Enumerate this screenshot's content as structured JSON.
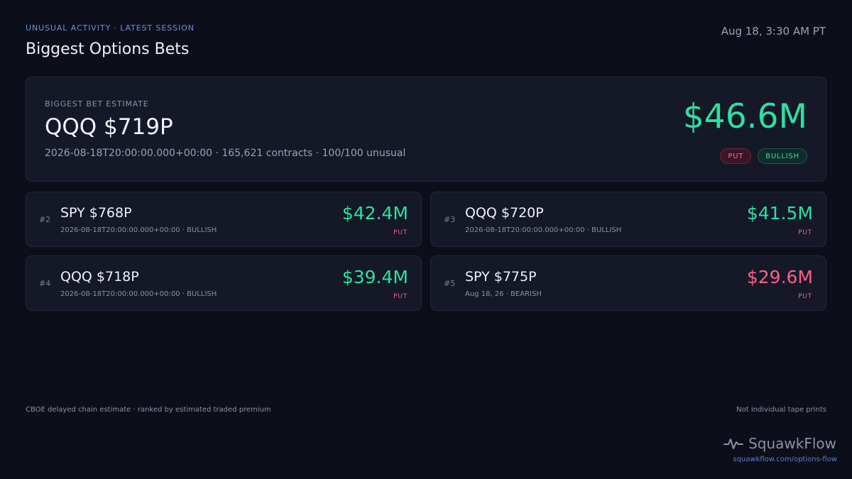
{
  "header": {
    "kicker": "UNUSUAL ACTIVITY · LATEST SESSION",
    "title": "Biggest Options Bets",
    "timestamp": "Aug 18, 3:30 AM PT"
  },
  "hero": {
    "label": "BIGGEST BET ESTIMATE",
    "contract": "QQQ $719P",
    "meta": "2026-08-18T20:00:00.000+00:00 · 165,621 contracts · 100/100 unusual",
    "premium": "$46.6M",
    "badges": {
      "type": "PUT",
      "sentiment": "BULLISH"
    }
  },
  "bets": [
    {
      "rank": "#2",
      "contract": "SPY $768P",
      "meta": "2026-08-18T20:00:00.000+00:00 · BULLISH",
      "premium": "$42.4M",
      "type": "PUT"
    },
    {
      "rank": "#3",
      "contract": "QQQ $720P",
      "meta": "2026-08-18T20:00:00.000+00:00 · BULLISH",
      "premium": "$41.5M",
      "type": "PUT"
    },
    {
      "rank": "#4",
      "contract": "QQQ $718P",
      "meta": "2026-08-18T20:00:00.000+00:00 · BULLISH",
      "premium": "$39.4M",
      "type": "PUT"
    },
    {
      "rank": "#5",
      "contract": "SPY $775P",
      "meta": "Aug 18, 26 · BEARISH",
      "premium": "$29.6M",
      "type": "PUT"
    }
  ],
  "footer": {
    "left": "CBOE delayed chain estimate · ranked by estimated traded premium",
    "right": "Not individual tape prints",
    "brand_name": "SquawkFlow",
    "brand_url": "squawkflow.com/options-flow",
    "brand_icon": "pulse-icon"
  },
  "colors": {
    "background": "#0c0e19",
    "card": "#141827",
    "bullish": "#2ee0a1",
    "bearish": "#ff5f83",
    "accent": "#6f8fe0"
  }
}
